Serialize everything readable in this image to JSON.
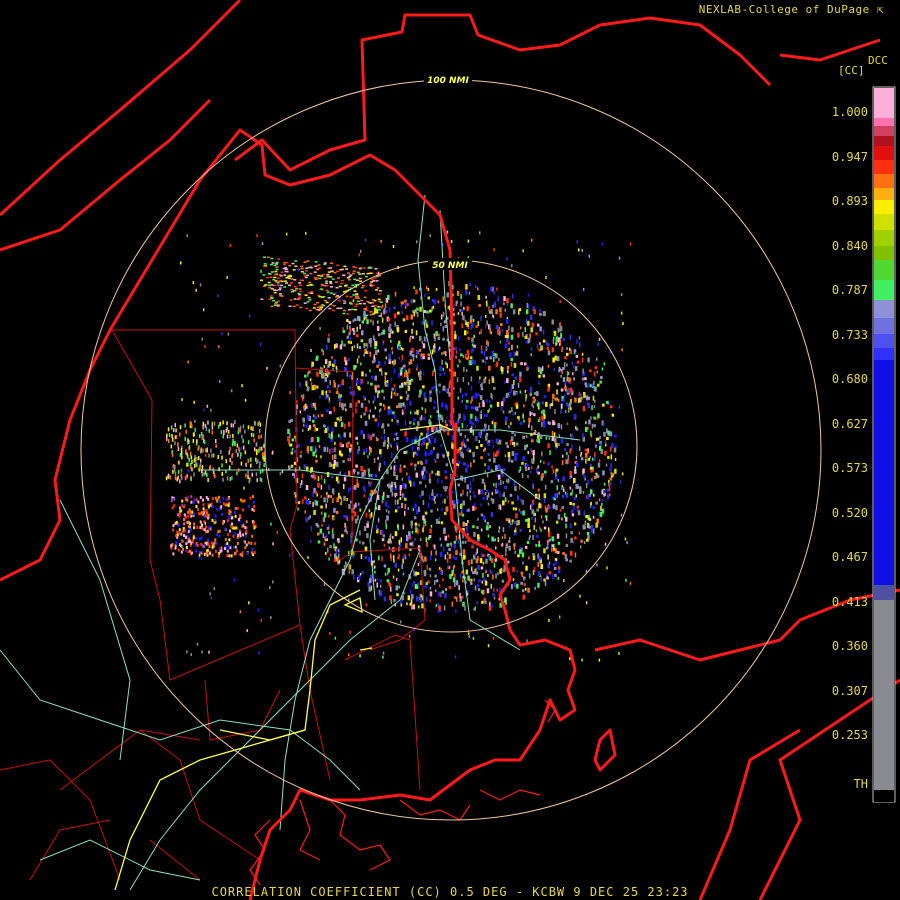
{
  "header": {
    "credit": "NEXLAB-College of DuPage"
  },
  "rings": [
    {
      "label": "100 NMI"
    },
    {
      "label": "50 NMI"
    }
  ],
  "colorbar": {
    "product": "DCC",
    "unit": "[CC]",
    "tick_labels": [
      "1.000",
      "0.947",
      "0.893",
      "0.840",
      "0.787",
      "0.733",
      "0.680",
      "0.627",
      "0.573",
      "0.520",
      "0.467",
      "0.413",
      "0.360",
      "0.307",
      "0.253",
      "TH"
    ]
  },
  "footer": {
    "caption": "CORRELATION COEFFICIENT (CC) 0.5 DEG - KCBW 9 DEC 25 23:23"
  },
  "colors": {
    "state_border": "#ff1a1a",
    "county_border": "#c81010",
    "highway": "#ffff44",
    "road": "#8fe0c0",
    "ring": "#f0c8a0",
    "text": "#e6d84a"
  }
}
